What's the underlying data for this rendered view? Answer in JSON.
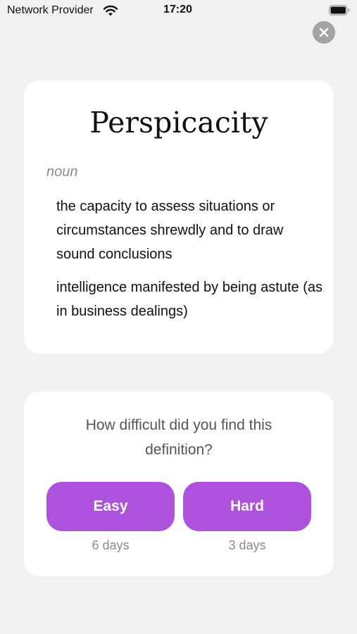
{
  "status_bar": {
    "provider": "Network Provider",
    "time": "17:20",
    "wifi_icon": "wifi-icon",
    "battery_icon": "battery-icon"
  },
  "close_icon": "close-icon",
  "word": {
    "title": "Perspicacity",
    "part_of_speech": "noun",
    "definitions": [
      "the capacity to assess situations or circumstances shrewdly and to draw sound conclusions",
      "intelligence manifested by being astute (as in business dealings)"
    ]
  },
  "feedback": {
    "question": "How difficult did you find this definition?",
    "options": [
      {
        "label": "Easy",
        "interval": "6 days"
      },
      {
        "label": "Hard",
        "interval": "3 days"
      }
    ]
  },
  "colors": {
    "accent": "#ad52dc",
    "background": "#f1f1f2",
    "card": "#ffffff",
    "muted_text": "#8b8b8e"
  }
}
